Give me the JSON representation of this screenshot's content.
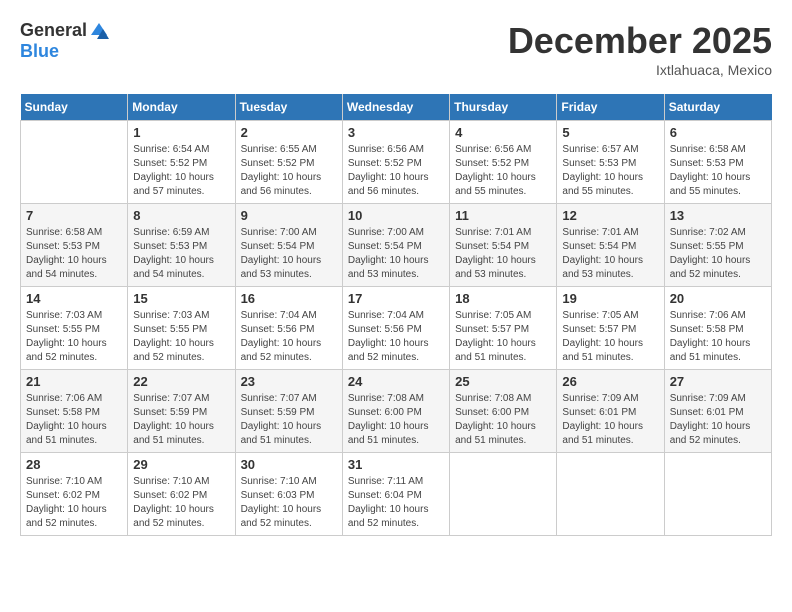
{
  "header": {
    "logo_general": "General",
    "logo_blue": "Blue",
    "title": "December 2025",
    "location": "Ixtlahuaca, Mexico"
  },
  "days_of_week": [
    "Sunday",
    "Monday",
    "Tuesday",
    "Wednesday",
    "Thursday",
    "Friday",
    "Saturday"
  ],
  "weeks": [
    [
      {
        "day": "",
        "sunrise": "",
        "sunset": "",
        "daylight": ""
      },
      {
        "day": "1",
        "sunrise": "Sunrise: 6:54 AM",
        "sunset": "Sunset: 5:52 PM",
        "daylight": "Daylight: 10 hours and 57 minutes."
      },
      {
        "day": "2",
        "sunrise": "Sunrise: 6:55 AM",
        "sunset": "Sunset: 5:52 PM",
        "daylight": "Daylight: 10 hours and 56 minutes."
      },
      {
        "day": "3",
        "sunrise": "Sunrise: 6:56 AM",
        "sunset": "Sunset: 5:52 PM",
        "daylight": "Daylight: 10 hours and 56 minutes."
      },
      {
        "day": "4",
        "sunrise": "Sunrise: 6:56 AM",
        "sunset": "Sunset: 5:52 PM",
        "daylight": "Daylight: 10 hours and 55 minutes."
      },
      {
        "day": "5",
        "sunrise": "Sunrise: 6:57 AM",
        "sunset": "Sunset: 5:53 PM",
        "daylight": "Daylight: 10 hours and 55 minutes."
      },
      {
        "day": "6",
        "sunrise": "Sunrise: 6:58 AM",
        "sunset": "Sunset: 5:53 PM",
        "daylight": "Daylight: 10 hours and 55 minutes."
      }
    ],
    [
      {
        "day": "7",
        "sunrise": "Sunrise: 6:58 AM",
        "sunset": "Sunset: 5:53 PM",
        "daylight": "Daylight: 10 hours and 54 minutes."
      },
      {
        "day": "8",
        "sunrise": "Sunrise: 6:59 AM",
        "sunset": "Sunset: 5:53 PM",
        "daylight": "Daylight: 10 hours and 54 minutes."
      },
      {
        "day": "9",
        "sunrise": "Sunrise: 7:00 AM",
        "sunset": "Sunset: 5:54 PM",
        "daylight": "Daylight: 10 hours and 53 minutes."
      },
      {
        "day": "10",
        "sunrise": "Sunrise: 7:00 AM",
        "sunset": "Sunset: 5:54 PM",
        "daylight": "Daylight: 10 hours and 53 minutes."
      },
      {
        "day": "11",
        "sunrise": "Sunrise: 7:01 AM",
        "sunset": "Sunset: 5:54 PM",
        "daylight": "Daylight: 10 hours and 53 minutes."
      },
      {
        "day": "12",
        "sunrise": "Sunrise: 7:01 AM",
        "sunset": "Sunset: 5:54 PM",
        "daylight": "Daylight: 10 hours and 53 minutes."
      },
      {
        "day": "13",
        "sunrise": "Sunrise: 7:02 AM",
        "sunset": "Sunset: 5:55 PM",
        "daylight": "Daylight: 10 hours and 52 minutes."
      }
    ],
    [
      {
        "day": "14",
        "sunrise": "Sunrise: 7:03 AM",
        "sunset": "Sunset: 5:55 PM",
        "daylight": "Daylight: 10 hours and 52 minutes."
      },
      {
        "day": "15",
        "sunrise": "Sunrise: 7:03 AM",
        "sunset": "Sunset: 5:55 PM",
        "daylight": "Daylight: 10 hours and 52 minutes."
      },
      {
        "day": "16",
        "sunrise": "Sunrise: 7:04 AM",
        "sunset": "Sunset: 5:56 PM",
        "daylight": "Daylight: 10 hours and 52 minutes."
      },
      {
        "day": "17",
        "sunrise": "Sunrise: 7:04 AM",
        "sunset": "Sunset: 5:56 PM",
        "daylight": "Daylight: 10 hours and 52 minutes."
      },
      {
        "day": "18",
        "sunrise": "Sunrise: 7:05 AM",
        "sunset": "Sunset: 5:57 PM",
        "daylight": "Daylight: 10 hours and 51 minutes."
      },
      {
        "day": "19",
        "sunrise": "Sunrise: 7:05 AM",
        "sunset": "Sunset: 5:57 PM",
        "daylight": "Daylight: 10 hours and 51 minutes."
      },
      {
        "day": "20",
        "sunrise": "Sunrise: 7:06 AM",
        "sunset": "Sunset: 5:58 PM",
        "daylight": "Daylight: 10 hours and 51 minutes."
      }
    ],
    [
      {
        "day": "21",
        "sunrise": "Sunrise: 7:06 AM",
        "sunset": "Sunset: 5:58 PM",
        "daylight": "Daylight: 10 hours and 51 minutes."
      },
      {
        "day": "22",
        "sunrise": "Sunrise: 7:07 AM",
        "sunset": "Sunset: 5:59 PM",
        "daylight": "Daylight: 10 hours and 51 minutes."
      },
      {
        "day": "23",
        "sunrise": "Sunrise: 7:07 AM",
        "sunset": "Sunset: 5:59 PM",
        "daylight": "Daylight: 10 hours and 51 minutes."
      },
      {
        "day": "24",
        "sunrise": "Sunrise: 7:08 AM",
        "sunset": "Sunset: 6:00 PM",
        "daylight": "Daylight: 10 hours and 51 minutes."
      },
      {
        "day": "25",
        "sunrise": "Sunrise: 7:08 AM",
        "sunset": "Sunset: 6:00 PM",
        "daylight": "Daylight: 10 hours and 51 minutes."
      },
      {
        "day": "26",
        "sunrise": "Sunrise: 7:09 AM",
        "sunset": "Sunset: 6:01 PM",
        "daylight": "Daylight: 10 hours and 51 minutes."
      },
      {
        "day": "27",
        "sunrise": "Sunrise: 7:09 AM",
        "sunset": "Sunset: 6:01 PM",
        "daylight": "Daylight: 10 hours and 52 minutes."
      }
    ],
    [
      {
        "day": "28",
        "sunrise": "Sunrise: 7:10 AM",
        "sunset": "Sunset: 6:02 PM",
        "daylight": "Daylight: 10 hours and 52 minutes."
      },
      {
        "day": "29",
        "sunrise": "Sunrise: 7:10 AM",
        "sunset": "Sunset: 6:02 PM",
        "daylight": "Daylight: 10 hours and 52 minutes."
      },
      {
        "day": "30",
        "sunrise": "Sunrise: 7:10 AM",
        "sunset": "Sunset: 6:03 PM",
        "daylight": "Daylight: 10 hours and 52 minutes."
      },
      {
        "day": "31",
        "sunrise": "Sunrise: 7:11 AM",
        "sunset": "Sunset: 6:04 PM",
        "daylight": "Daylight: 10 hours and 52 minutes."
      },
      {
        "day": "",
        "sunrise": "",
        "sunset": "",
        "daylight": ""
      },
      {
        "day": "",
        "sunrise": "",
        "sunset": "",
        "daylight": ""
      },
      {
        "day": "",
        "sunrise": "",
        "sunset": "",
        "daylight": ""
      }
    ]
  ]
}
